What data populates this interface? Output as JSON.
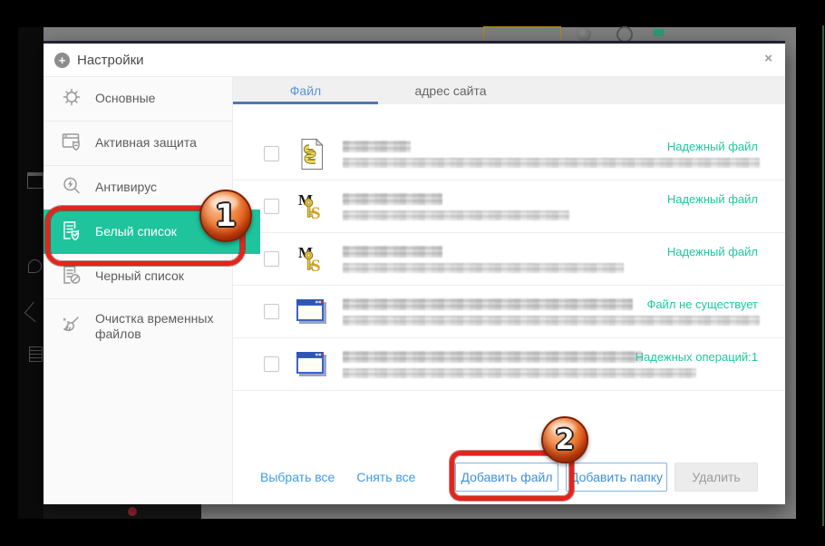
{
  "dialog": {
    "title": "Настройки",
    "close_label": "×",
    "title_icon": "+",
    "sidebar": {
      "items": [
        {
          "label": "Основные",
          "icon": "gear-icon",
          "active": false
        },
        {
          "label": "Активная защита",
          "icon": "shield-window-icon",
          "active": false
        },
        {
          "label": "Антивирус",
          "icon": "antivirus-magnifier-icon",
          "active": false
        },
        {
          "label": "Белый список",
          "icon": "whitelist-doc-shield-icon",
          "active": true
        },
        {
          "label": "Черный список",
          "icon": "blacklist-doc-block-icon",
          "active": false
        },
        {
          "label": "Очистка временных файлов",
          "icon": "broom-icon",
          "active": false
        }
      ]
    },
    "tabs": [
      {
        "label": "Файл",
        "active": true
      },
      {
        "label": "адрес сайта",
        "active": false
      }
    ],
    "file_list": {
      "rows": [
        {
          "icon": "script-file-icon",
          "status": "Надежный файл",
          "name_redacted": true,
          "path_redacted": true
        },
        {
          "icon": "ms-key-icon",
          "status": "Надежный файл",
          "name_redacted": true,
          "path_redacted": true
        },
        {
          "icon": "ms-key-icon",
          "status": "Надежный файл",
          "name_redacted": true,
          "path_redacted": true
        },
        {
          "icon": "app-window-icon",
          "status": "Файл не существует",
          "name_redacted": true,
          "path_redacted": true
        },
        {
          "icon": "app-window-icon",
          "status": "Надежных операций:1",
          "name_redacted": true,
          "path_redacted": true
        }
      ]
    },
    "footer": {
      "select_all": "Выбрать все",
      "deselect_all": "Снять все",
      "add_file_button": "Добавить файл",
      "add_folder_button": "Добавить папку",
      "delete_button": "Удалить"
    }
  },
  "annotations": {
    "step1_badge": "1",
    "step2_badge": "2",
    "highlight_color": "#e3251c"
  },
  "colors": {
    "accent_teal": "#1fc39c",
    "status_green": "#1ec99e",
    "link_blue": "#3d9be9",
    "tab_active_blue": "#5b93d8"
  }
}
